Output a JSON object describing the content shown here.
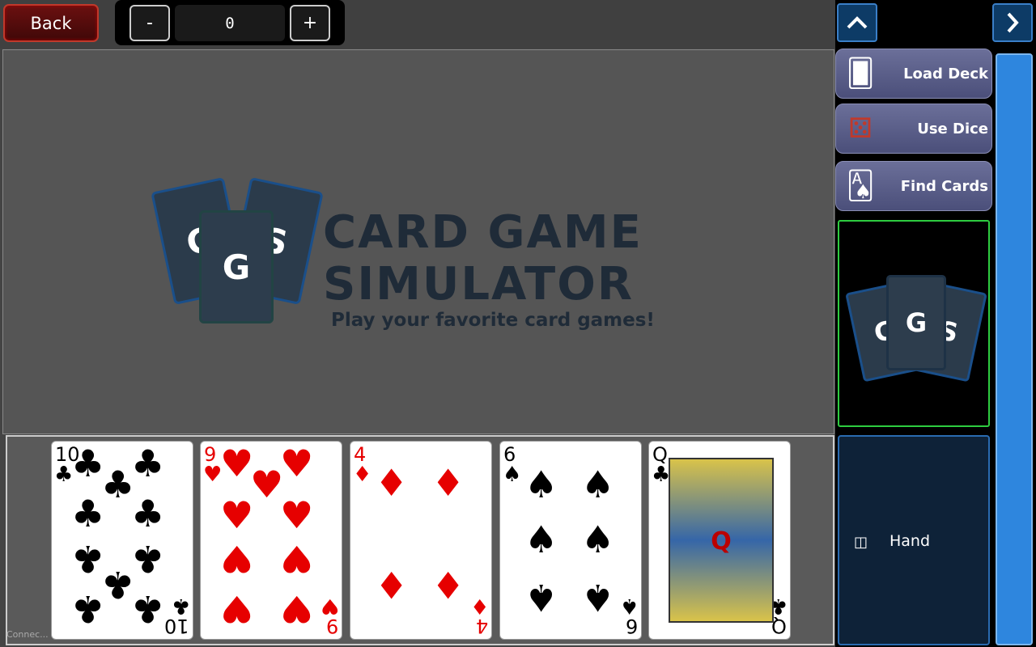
{
  "topbar": {
    "back_label": "Back",
    "counter": {
      "minus_label": "-",
      "value": "0",
      "plus_label": "+"
    }
  },
  "logo": {
    "letters": [
      "C",
      "G",
      "S"
    ],
    "title_line1": "CARD GAME",
    "title_line2": "SIMULATOR",
    "tagline": "Play your favorite card games!"
  },
  "hand": {
    "cards": [
      {
        "rank": "10",
        "suit": "♣",
        "color": "#000000"
      },
      {
        "rank": "9",
        "suit": "♥",
        "color": "#e60000"
      },
      {
        "rank": "4",
        "suit": "♦",
        "color": "#e60000"
      },
      {
        "rank": "6",
        "suit": "♠",
        "color": "#000000"
      },
      {
        "rank": "Q",
        "suit": "♣",
        "color": "#000000"
      }
    ]
  },
  "status_text": "Connec...",
  "right_panel": {
    "up_icon": "chevron-up-icon",
    "next_icon": "chevron-right-icon",
    "menu": [
      {
        "label": "Load Deck",
        "icon": "deck-icon"
      },
      {
        "label": "Use Dice",
        "icon": "dice-icon"
      },
      {
        "label": "Find Cards",
        "icon": "cards-icon"
      }
    ],
    "preview_letters": [
      "C",
      "G",
      "S"
    ],
    "hand_zone": {
      "icon": "hand-stack-icon",
      "label": "Hand"
    }
  },
  "colors": {
    "accent_blue": "#2e86de",
    "preview_border": "#2ecc40",
    "back_border": "#c0392b"
  }
}
